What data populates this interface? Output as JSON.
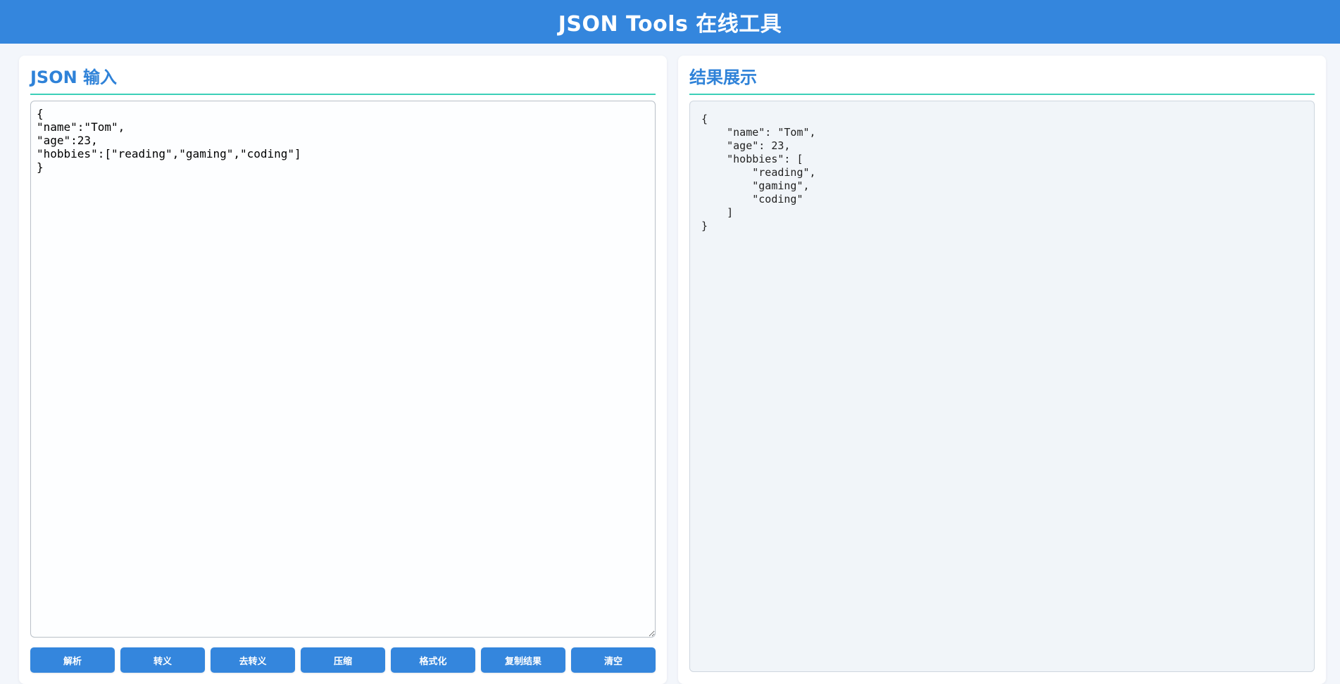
{
  "header": {
    "title": "JSON Tools 在线工具"
  },
  "input_panel": {
    "title": "JSON 输入",
    "value": "{\n\"name\":\"Tom\",\n\"age\":23,\n\"hobbies\":[\"reading\",\"gaming\",\"coding\"]\n}"
  },
  "buttons": {
    "parse": "解析",
    "escape": "转义",
    "unescape": "去转义",
    "compress": "压缩",
    "format": "格式化",
    "copy": "复制结果",
    "clear": "清空"
  },
  "result_panel": {
    "title": "结果展示",
    "value": "{\n    \"name\": \"Tom\",\n    \"age\": 23,\n    \"hobbies\": [\n        \"reading\",\n        \"gaming\",\n        \"coding\"\n    ]\n}"
  },
  "colors": {
    "primary": "#3486dd",
    "title_text": "#2f82d8",
    "title_underline": "#3ccfb8",
    "page_background": "#f3f6fb",
    "result_background": "#f1f5f9"
  }
}
